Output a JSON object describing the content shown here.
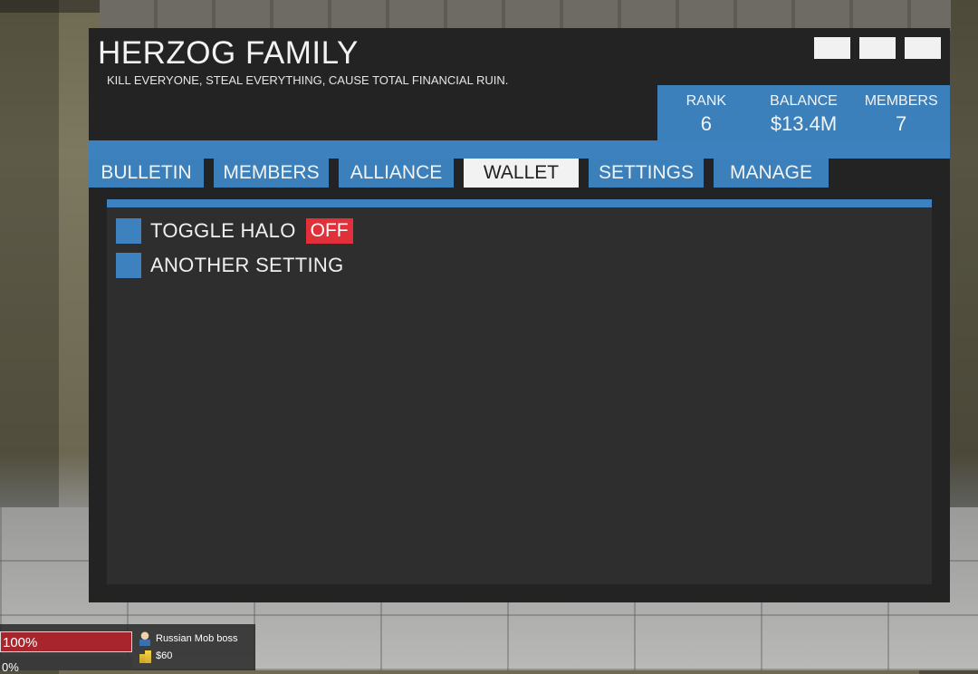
{
  "window": {
    "title": "HERZOG FAMILY",
    "motto": "KILL EVERYONE, STEAL EVERYTHING, CAUSE TOTAL FINANCIAL RUIN."
  },
  "stats": {
    "rank_label": "RANK",
    "rank_value": "6",
    "balance_label": "BALANCE",
    "balance_value": "$13.4M",
    "members_label": "MEMBERS",
    "members_value": "7"
  },
  "tabs": [
    {
      "label": "BULLETIN"
    },
    {
      "label": "MEMBERS"
    },
    {
      "label": "ALLIANCE"
    },
    {
      "label": "WALLET",
      "active": true
    },
    {
      "label": "SETTINGS"
    },
    {
      "label": "MANAGE"
    }
  ],
  "settings": [
    {
      "label": "TOGGLE HALO",
      "state": "OFF"
    },
    {
      "label": "ANOTHER SETTING"
    }
  ],
  "hud": {
    "health_text": "100%",
    "health": 1.0,
    "armor_text": "0%",
    "job": "Russian Mob boss",
    "money": "$60"
  },
  "colors": {
    "accent": "#3c80bb",
    "window_bg": "#232323",
    "panel_bg": "#2e2e2e",
    "off_badge": "#e0313a",
    "health_bar": "#a8252d"
  }
}
